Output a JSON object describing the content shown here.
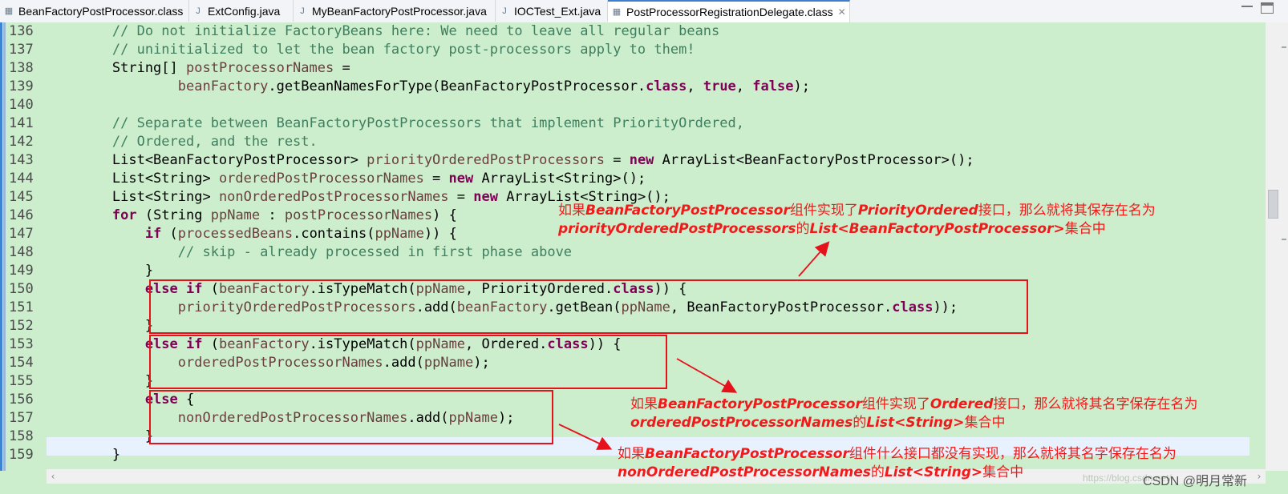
{
  "tabs": [
    {
      "label": "BeanFactoryPostProcessor.class",
      "icon": "class-file-icon",
      "active": false
    },
    {
      "label": "ExtConfig.java",
      "icon": "java-file-icon",
      "active": false
    },
    {
      "label": "MyBeanFactoryPostProcessor.java",
      "icon": "java-file-icon",
      "active": false
    },
    {
      "label": "IOCTest_Ext.java",
      "icon": "java-file-icon",
      "active": false
    },
    {
      "label": "PostProcessorRegistrationDelegate.class",
      "icon": "class-file-icon",
      "active": true
    }
  ],
  "tab_close_glyph": "✕",
  "window_controls": {
    "minimize_icon": "minimize-icon",
    "maximize_icon": "maximize-icon"
  },
  "code_lines": [
    {
      "n": "136",
      "tokens": [
        [
          "",
          "\t\t"
        ],
        [
          "cm",
          "// Do not initialize FactoryBeans here: We need to leave all regular beans"
        ]
      ]
    },
    {
      "n": "137",
      "tokens": [
        [
          "",
          "\t\t"
        ],
        [
          "cm",
          "// uninitialized to let the bean factory post-processors apply to them!"
        ]
      ]
    },
    {
      "n": "138",
      "tokens": [
        [
          "",
          "\t\tString[] "
        ],
        [
          "var",
          "postProcessorNames"
        ],
        [
          "",
          " ="
        ]
      ]
    },
    {
      "n": "139",
      "tokens": [
        [
          "",
          "\t\t\t\t"
        ],
        [
          "var",
          "beanFactory"
        ],
        [
          "",
          ".getBeanNamesForType(BeanFactoryPostProcessor."
        ],
        [
          "kw",
          "class"
        ],
        [
          "",
          ", "
        ],
        [
          "kw",
          "true"
        ],
        [
          "",
          ", "
        ],
        [
          "kw",
          "false"
        ],
        [
          "",
          ");"
        ]
      ]
    },
    {
      "n": "140",
      "tokens": [
        [
          "",
          ""
        ]
      ]
    },
    {
      "n": "141",
      "tokens": [
        [
          "",
          "\t\t"
        ],
        [
          "cm",
          "// Separate between BeanFactoryPostProcessors that implement PriorityOrdered,"
        ]
      ]
    },
    {
      "n": "142",
      "tokens": [
        [
          "",
          "\t\t"
        ],
        [
          "cm",
          "// Ordered, and the rest."
        ]
      ]
    },
    {
      "n": "143",
      "tokens": [
        [
          "",
          "\t\tList<BeanFactoryPostProcessor> "
        ],
        [
          "var",
          "priorityOrderedPostProcessors"
        ],
        [
          "",
          " = "
        ],
        [
          "kw",
          "new"
        ],
        [
          "",
          " ArrayList<BeanFactoryPostProcessor>();"
        ]
      ]
    },
    {
      "n": "144",
      "tokens": [
        [
          "",
          "\t\tList<String> "
        ],
        [
          "var",
          "orderedPostProcessorNames"
        ],
        [
          "",
          " = "
        ],
        [
          "kw",
          "new"
        ],
        [
          "",
          " ArrayList<String>();"
        ]
      ]
    },
    {
      "n": "145",
      "tokens": [
        [
          "",
          "\t\tList<String> "
        ],
        [
          "var",
          "nonOrderedPostProcessorNames"
        ],
        [
          "",
          " = "
        ],
        [
          "kw",
          "new"
        ],
        [
          "",
          " ArrayList<String>();"
        ]
      ]
    },
    {
      "n": "146",
      "tokens": [
        [
          "",
          "\t\t"
        ],
        [
          "kw",
          "for"
        ],
        [
          "",
          " (String "
        ],
        [
          "var",
          "ppName"
        ],
        [
          "",
          " : "
        ],
        [
          "var",
          "postProcessorNames"
        ],
        [
          "",
          ") {"
        ]
      ]
    },
    {
      "n": "147",
      "tokens": [
        [
          "",
          "\t\t\t"
        ],
        [
          "kw",
          "if"
        ],
        [
          "",
          " ("
        ],
        [
          "var",
          "processedBeans"
        ],
        [
          "",
          ".contains("
        ],
        [
          "var",
          "ppName"
        ],
        [
          "",
          ")) {"
        ]
      ]
    },
    {
      "n": "148",
      "tokens": [
        [
          "",
          "\t\t\t\t"
        ],
        [
          "cm",
          "// skip - already processed in first phase above"
        ]
      ]
    },
    {
      "n": "149",
      "tokens": [
        [
          "",
          "\t\t\t}"
        ]
      ]
    },
    {
      "n": "150",
      "tokens": [
        [
          "",
          "\t\t\t"
        ],
        [
          "kw",
          "else if"
        ],
        [
          "",
          " ("
        ],
        [
          "var",
          "beanFactory"
        ],
        [
          "",
          ".isTypeMatch("
        ],
        [
          "var",
          "ppName"
        ],
        [
          "",
          ", PriorityOrdered."
        ],
        [
          "kw",
          "class"
        ],
        [
          "",
          ")) {"
        ]
      ]
    },
    {
      "n": "151",
      "tokens": [
        [
          "",
          "\t\t\t\t"
        ],
        [
          "var",
          "priorityOrderedPostProcessors"
        ],
        [
          "",
          ".add("
        ],
        [
          "var",
          "beanFactory"
        ],
        [
          "",
          ".getBean("
        ],
        [
          "var",
          "ppName"
        ],
        [
          "",
          ", BeanFactoryPostProcessor."
        ],
        [
          "kw",
          "class"
        ],
        [
          "",
          "));"
        ]
      ]
    },
    {
      "n": "152",
      "tokens": [
        [
          "",
          "\t\t\t}"
        ]
      ]
    },
    {
      "n": "153",
      "tokens": [
        [
          "",
          "\t\t\t"
        ],
        [
          "kw",
          "else if"
        ],
        [
          "",
          " ("
        ],
        [
          "var",
          "beanFactory"
        ],
        [
          "",
          ".isTypeMatch("
        ],
        [
          "var",
          "ppName"
        ],
        [
          "",
          ", Ordered."
        ],
        [
          "kw",
          "class"
        ],
        [
          "",
          ")) {"
        ]
      ]
    },
    {
      "n": "154",
      "tokens": [
        [
          "",
          "\t\t\t\t"
        ],
        [
          "var",
          "orderedPostProcessorNames"
        ],
        [
          "",
          ".add("
        ],
        [
          "var",
          "ppName"
        ],
        [
          "",
          ");"
        ]
      ]
    },
    {
      "n": "155",
      "tokens": [
        [
          "",
          "\t\t\t}"
        ]
      ]
    },
    {
      "n": "156",
      "tokens": [
        [
          "",
          "\t\t\t"
        ],
        [
          "kw",
          "else"
        ],
        [
          "",
          " {"
        ]
      ]
    },
    {
      "n": "157",
      "tokens": [
        [
          "",
          "\t\t\t\t"
        ],
        [
          "var",
          "nonOrderedPostProcessorNames"
        ],
        [
          "",
          ".add("
        ],
        [
          "var",
          "ppName"
        ],
        [
          "",
          ");"
        ]
      ]
    },
    {
      "n": "158",
      "tokens": [
        [
          "",
          "\t\t\t}"
        ]
      ]
    },
    {
      "n": "159",
      "tokens": [
        [
          "",
          "\t\t}"
        ]
      ]
    }
  ],
  "annotations": {
    "note1": {
      "line1": [
        [
          "",
          "如果"
        ],
        [
          "em",
          "BeanFactoryPostProcessor"
        ],
        [
          "",
          "组件实现了"
        ],
        [
          "em",
          "PriorityOrdered"
        ],
        [
          "",
          "接口，那么就将其保存在名为"
        ]
      ],
      "line2": [
        [
          "em",
          "priorityOrderedPostProcessors"
        ],
        [
          "",
          "的"
        ],
        [
          "em",
          "List<BeanFactoryPostProcessor>"
        ],
        [
          "",
          "集合中"
        ]
      ]
    },
    "note2": {
      "line1": [
        [
          "",
          "如果"
        ],
        [
          "em",
          "BeanFactoryPostProcessor"
        ],
        [
          "",
          "组件实现了"
        ],
        [
          "em",
          "Ordered"
        ],
        [
          "",
          "接口，那么就将其名字保存在名为"
        ]
      ],
      "line2": [
        [
          "em",
          "orderedPostProcessorNames"
        ],
        [
          "",
          "的"
        ],
        [
          "em",
          "List<String>"
        ],
        [
          "",
          "集合中"
        ]
      ]
    },
    "note3": {
      "line1": [
        [
          "",
          "如果"
        ],
        [
          "em",
          "BeanFactoryPostProcessor"
        ],
        [
          "",
          "组件什么接口都没有实现，那么就将其名字保存在名为"
        ]
      ],
      "line2": [
        [
          "em",
          "nonOrderedPostProcessorNames"
        ],
        [
          "",
          "的"
        ],
        [
          "em",
          "List<String>"
        ],
        [
          "",
          "集合中"
        ]
      ]
    },
    "color": "#f01a1a"
  },
  "editor_colors": {
    "background": "#cceecd",
    "comment": "#3f7f5f",
    "keyword": "#7f0055",
    "variable": "#6a3e3e",
    "box": "#e5121b"
  },
  "watermark": "CSDN @明月常新"
}
